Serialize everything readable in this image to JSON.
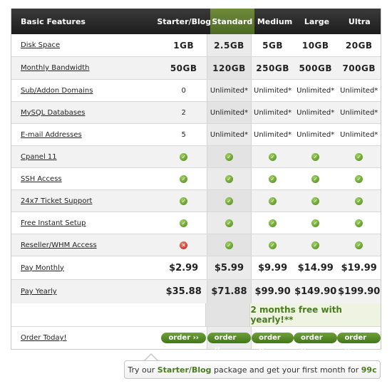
{
  "header": {
    "feature_col": "Basic Features",
    "plans": [
      "Starter/Blog",
      "Standard",
      "Medium",
      "Large",
      "Ultra"
    ]
  },
  "rows": [
    {
      "label": "Disk Space",
      "values": [
        "1GB",
        "2.5GB",
        "5GB",
        "10GB",
        "20GB"
      ]
    },
    {
      "label": "Monthly Bandwidth",
      "values": [
        "50GB",
        "120GB",
        "250GB",
        "500GB",
        "700GB"
      ]
    },
    {
      "label": "Sub/Addon Domains",
      "values": [
        "0",
        "Unlimited*",
        "Unlimited*",
        "Unlimited*",
        "Unlimited*"
      ]
    },
    {
      "label": "MySQL Databases",
      "values": [
        "2",
        "Unlimited*",
        "Unlimited*",
        "Unlimited*",
        "Unlimited*"
      ]
    },
    {
      "label": "E-mail Addresses",
      "values": [
        "5",
        "Unlimited*",
        "Unlimited*",
        "Unlimited*",
        "Unlimited*"
      ]
    },
    {
      "label": "Cpanel 11",
      "values": [
        "check",
        "check",
        "check",
        "check",
        "check"
      ]
    },
    {
      "label": "SSH Access",
      "values": [
        "check",
        "check",
        "check",
        "check",
        "check"
      ]
    },
    {
      "label": "24x7 Ticket Support",
      "values": [
        "check",
        "check",
        "check",
        "check",
        "check"
      ]
    },
    {
      "label": "Free Instant Setup",
      "values": [
        "check",
        "check",
        "check",
        "check",
        "check"
      ]
    },
    {
      "label": "Reseller/WHM Access",
      "values": [
        "cross",
        "check",
        "check",
        "check",
        "check"
      ]
    },
    {
      "label": "Pay Monthly",
      "values": [
        "$2.99",
        "$5.99",
        "$9.99",
        "$14.99",
        "$19.99"
      ]
    },
    {
      "label": "Pay Yearly",
      "values": [
        "$35.88",
        "$71.88",
        "$99.90",
        "$149.90",
        "$199.90"
      ]
    }
  ],
  "promo": "2 months free with yearly!**",
  "order": {
    "label": "Order Today!",
    "button_label": "order ››"
  },
  "tip": {
    "prefix": "Try our",
    "plan": "Starter/Blog",
    "middle": "package and get your first month for",
    "price": "99c"
  },
  "icons": {
    "included": "check-icon",
    "excluded": "cross-icon"
  },
  "colors": {
    "accent": "#4a7c1d",
    "header_bg": "#2a2a2a",
    "standard_header": "#5a7a2c",
    "excluded": "#c0392b"
  }
}
